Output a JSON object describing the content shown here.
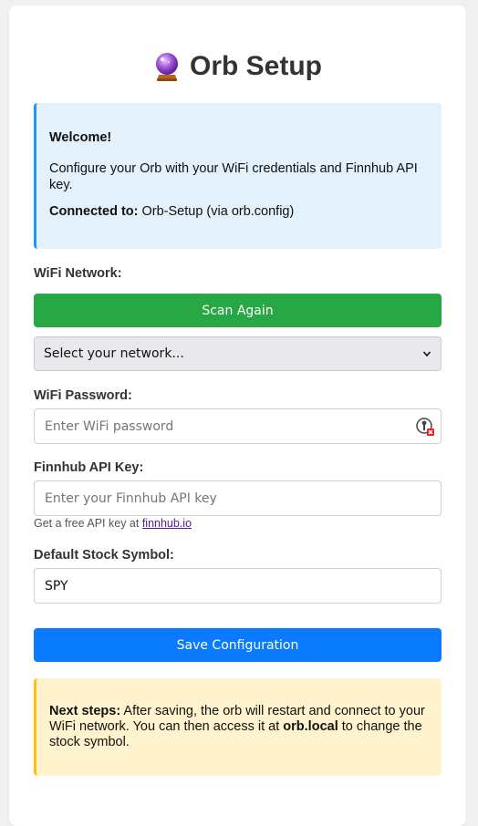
{
  "header": {
    "title": "Orb Setup",
    "icon": "crystal-ball-icon"
  },
  "info": {
    "welcome": "Welcome!",
    "description": "Configure your Orb with your WiFi credentials and Finnhub API key.",
    "connected_label": "Connected to:",
    "connected_value": "Orb-Setup (via orb.config)"
  },
  "wifi": {
    "label": "WiFi Network:",
    "scan_button": "Scan Again",
    "select_selected": "Select your network..."
  },
  "password": {
    "label": "WiFi Password:",
    "placeholder": "Enter WiFi password"
  },
  "api": {
    "label": "Finnhub API Key:",
    "placeholder": "Enter your Finnhub API key",
    "hint_prefix": "Get a free API key at",
    "hint_link": "finnhub.io"
  },
  "symbol": {
    "label": "Default Stock Symbol:",
    "value": "SPY"
  },
  "save_button": "Save Configuration",
  "next_steps": {
    "label": "Next steps:",
    "text_1": "After saving, the orb will restart and connect to your WiFi network. You can then access it at",
    "host": "orb.local",
    "text_2": "to change the stock symbol."
  },
  "colors": {
    "primary": "#0a7bff",
    "success": "#28a745",
    "info_bg": "#e3f1fc",
    "info_border": "#2196f3",
    "warn_bg": "#fff3cd",
    "warn_border": "#ffc107"
  }
}
